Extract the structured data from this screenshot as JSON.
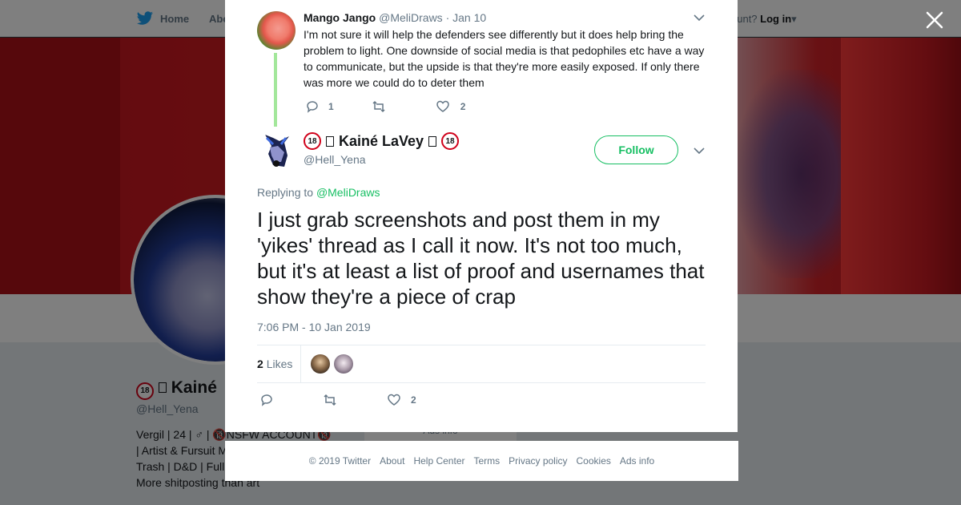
{
  "background_page": {
    "nav": {
      "home_label": "Home",
      "about_label": "Abo",
      "account_prompt": "ccount?",
      "login_label": "Log in"
    },
    "profile": {
      "name": "Kainé",
      "handle": "@Hell_Yena",
      "bio_lines": [
        "Vergil | 24 | ♂ | 🔞NSFW ACCOUNT🔞",
        "| Artist & Fursuit M",
        "Trash | D&D | Full",
        "More shitposting than art"
      ]
    },
    "ads_info": "Ads info"
  },
  "modal": {
    "parent_tweet": {
      "name": "Mango Jango",
      "handle": "@MeliDraws",
      "date": "· Jan 10",
      "text": "I'm not sure it will help the defenders see differently but it does help bring the problem to light. One downside of social media is that pedophiles etc have a way to communicate, but the upside is that they're more easily exposed. If only there was more we could do to deter them",
      "reply_count": "1",
      "like_count": "2"
    },
    "main_tweet": {
      "name": "Kainé LaVey",
      "badge": "18",
      "handle": "@Hell_Yena",
      "follow_label": "Follow",
      "replying_prefix": "Replying to",
      "replying_to": "@MeliDraws",
      "text": "I just grab screenshots and post them in my 'yikes' thread as I call it now.  It's not too much, but it's at least a list of proof and usernames that show they're a piece of crap",
      "timestamp": "7:06 PM - 10 Jan 2019",
      "likes_count": "2",
      "likes_label": "Likes",
      "like_count_action": "2"
    }
  },
  "footer": {
    "links": [
      "© 2019 Twitter",
      "About",
      "Help Center",
      "Terms",
      "Privacy policy",
      "Cookies",
      "Ads info"
    ]
  },
  "colors": {
    "accent": "#17bf63",
    "text": "#14171a",
    "muted": "#657786",
    "thread_line": "#a3e79b"
  }
}
